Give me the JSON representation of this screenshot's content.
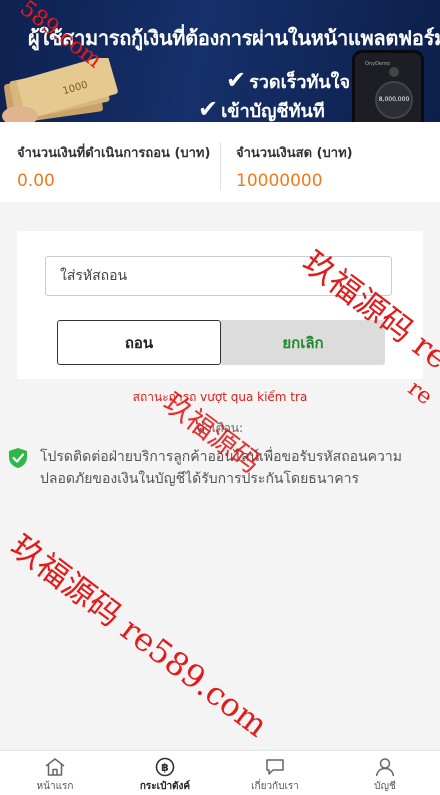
{
  "banner": {
    "title": "ผู้ใช้สามารถกู้เงินที่ต้องการผ่านในหน้าแพลตฟอร์ม",
    "check1": "รวดเร็วทันใจ",
    "check2": "เข้าบัญชีทันที",
    "phone_amount": "8,000,000",
    "phone_title": "OnyDemo",
    "money_label": "1000"
  },
  "stats": {
    "processing_label": "จำนวนเงินที่ดำเนินการถอน (บาท)",
    "processing_value": "0.00",
    "cash_label": "จำนวนเงินสด (บาท)",
    "cash_value": "10000000"
  },
  "form": {
    "code_placeholder": "ใส่รหัสถอน",
    "withdraw_label": "ถอน",
    "cancel_label": "ยกเลิก"
  },
  "status_text": "สถานะการถ vượt qua kiểm tra",
  "note": {
    "label": "คำเตือน:",
    "text": "โปรดติดต่อฝ่ายบริการลูกค้าออนไลน์เพื่อขอรับรหัสถอนความปลอดภัยของเงินในบัญชีได้รับการประกันโดยธนาคาร"
  },
  "watermarks": {
    "w1": "玖福源码 re",
    "w2": "玖福源码",
    "w3": "玖福源码 re589.com",
    "w4": "589.com",
    "w5": "re"
  },
  "watermark_line": "玖福源码 re589.com",
  "tabs": [
    {
      "label": "หน้าแรก",
      "icon": "home-icon"
    },
    {
      "label": "กระเป๋าตังค์",
      "icon": "wallet-icon"
    },
    {
      "label": "เกี่ยวกับเรา",
      "icon": "chat-icon"
    },
    {
      "label": "บัญชี",
      "icon": "user-icon"
    }
  ],
  "colors": {
    "banner": "#16306a",
    "value_orange": "#f07a1c",
    "status_red": "#d9201c",
    "cancel_green": "#1f8a2a",
    "shield_green": "#2eb84a"
  }
}
